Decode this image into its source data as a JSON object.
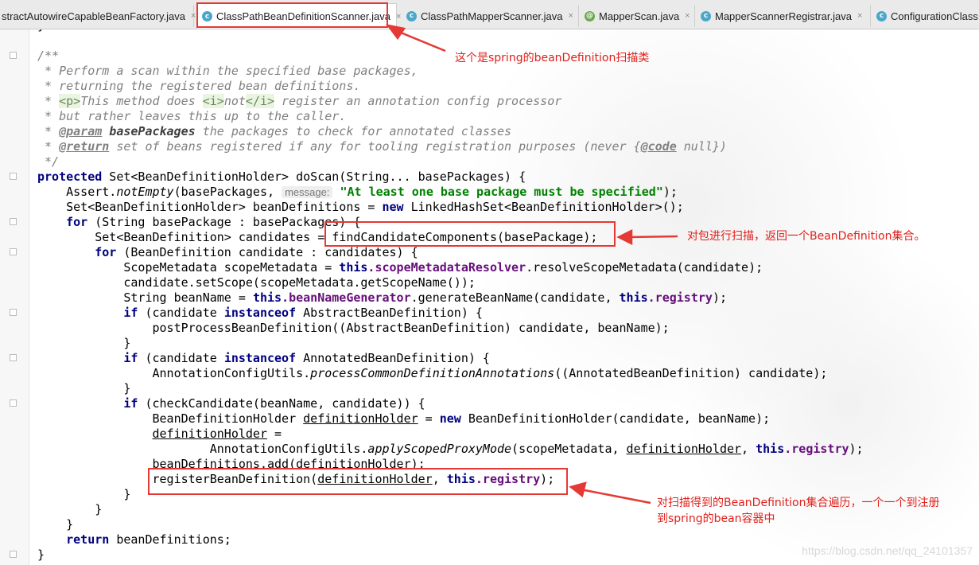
{
  "tabs": [
    {
      "label": "stractAutowireCapableBeanFactory.java",
      "icon": "class-icon",
      "active": false
    },
    {
      "label": "ClassPathBeanDefinitionScanner.java",
      "icon": "class-icon",
      "active": true
    },
    {
      "label": "ClassPathMapperScanner.java",
      "icon": "class-icon",
      "active": false
    },
    {
      "label": "MapperScan.java",
      "icon": "annotation-icon",
      "active": false
    },
    {
      "label": "MapperScannerRegistrar.java",
      "icon": "class-icon",
      "active": false
    },
    {
      "label": "ConfigurationClass",
      "icon": "class-icon",
      "active": false
    }
  ],
  "tab_close_glyph": "×",
  "code": {
    "l0": "}",
    "c1": "/**",
    "c2": " * Perform a scan within the specified base packages,",
    "c3": " * returning the registered bean definitions.",
    "c4a": " * ",
    "c4_p": "<p>",
    "c4b": "This method does ",
    "c4_i": "<i>",
    "c4c": "not",
    "c4_i2": "</i>",
    "c4d": " register an annotation config processor",
    "c5": " * but rather leaves this up to the caller.",
    "c6a": " * ",
    "c6_tag": "@param",
    "c6_name": " basePackages",
    "c6b": " the packages to check for annotated classes",
    "c7a": " * ",
    "c7_tag": "@return",
    "c7b": " set of beans registered if any for tooling registration purposes (never {",
    "c7_code": "@code",
    "c7c": " null})",
    "c8": " */",
    "m_kw": "protected",
    "m_rest": " Set<BeanDefinitionHolder> doScan(String... basePackages) {",
    "a1": "    Assert.",
    "a1_m": "notEmpty",
    "a1b": "(basePackages, ",
    "a1_hint": "message:",
    "a1_str": "\"At least one base package must be specified\"",
    "a1c": ");",
    "s1a": "    Set<BeanDefinitionHolder> beanDefinitions = ",
    "s1_kw": "new",
    "s1b": " LinkedHashSet<BeanDefinitionHolder>();",
    "f1_pre": "    ",
    "f1_kw": "for",
    "f1": " (String basePackage : basePackages) {",
    "f2": "        Set<BeanDefinition> candidates = findCandidateComponents(basePackage);",
    "f3_pre": "        ",
    "f3_kw": "for",
    "f3": " (BeanDefinition candidate : candidates) {",
    "f4a": "            ScopeMetadata scopeMetadata = ",
    "f4_this": "this",
    "f4_fld": ".scopeMetadataResolver",
    "f4b": ".resolveScopeMetadata(candidate);",
    "f5": "            candidate.setScope(scopeMetadata.getScopeName());",
    "f6a": "            String beanName = ",
    "f6_this": "this",
    "f6_fld": ".beanNameGenerator",
    "f6b": ".generateBeanName(candidate, ",
    "f6_this2": "this",
    "f6_fld2": ".registry",
    "f6c": ");",
    "f7_pre": "            ",
    "f7_kw": "if",
    "f7a": " (candidate ",
    "f7_kw2": "instanceof",
    "f7b": " AbstractBeanDefinition) {",
    "f8": "                postProcessBeanDefinition((AbstractBeanDefinition) candidate, beanName);",
    "f9": "            }",
    "f10_pre": "            ",
    "f10_kw": "if",
    "f10a": " (candidate ",
    "f10_kw2": "instanceof",
    "f10b": " AnnotatedBeanDefinition) {",
    "f11a": "                AnnotationConfigUtils.",
    "f11_m": "processCommonDefinitionAnnotations",
    "f11b": "((AnnotatedBeanDefinition) candidate);",
    "f12": "            }",
    "f13_pre": "            ",
    "f13_kw": "if",
    "f13": " (checkCandidate(beanName, candidate)) {",
    "f14a": "                BeanDefinitionHolder ",
    "f14_v": "definitionHolder",
    "f14b": " = ",
    "f14_kw": "new",
    "f14c": " BeanDefinitionHolder(candidate, beanName);",
    "f15_pre": "                ",
    "f15_v": "definitionHolder",
    "f15": " =",
    "f16a": "                        AnnotationConfigUtils.",
    "f16_m": "applyScopedProxyMode",
    "f16b": "(scopeMetadata, ",
    "f16_v": "definitionHolder",
    "f16c": ", ",
    "f16_this": "this",
    "f16_fld": ".registry",
    "f16d": ");",
    "f17a": "                beanDefinitions.add(",
    "f17_v": "definitionHolder",
    "f17b": ");",
    "f18a": "                registerBeanDefinition(",
    "f18_v": "definitionHolder",
    "f18b": ", ",
    "f18_this": "this",
    "f18_fld": ".registry",
    "f18c": ");",
    "f19": "            }",
    "f20": "        }",
    "f21": "    }",
    "r_pre": "    ",
    "r_kw": "return",
    "r": " beanDefinitions;",
    "end": "}"
  },
  "annotations": {
    "tab_note": "这个是spring的beanDefinition扫描类",
    "find_note": "对包进行扫描，返回一个BeanDefinition集合。",
    "register_note_1": "对扫描得到的BeanDefinition集合遍历，一个一个到注册",
    "register_note_2": "到spring的bean容器中"
  },
  "watermark": "https://blog.csdn.net/qq_24101357",
  "colors": {
    "annotation_red": "#e53935",
    "keyword": "#000080",
    "string": "#008000",
    "field": "#660e7a",
    "comment": "#808080"
  }
}
